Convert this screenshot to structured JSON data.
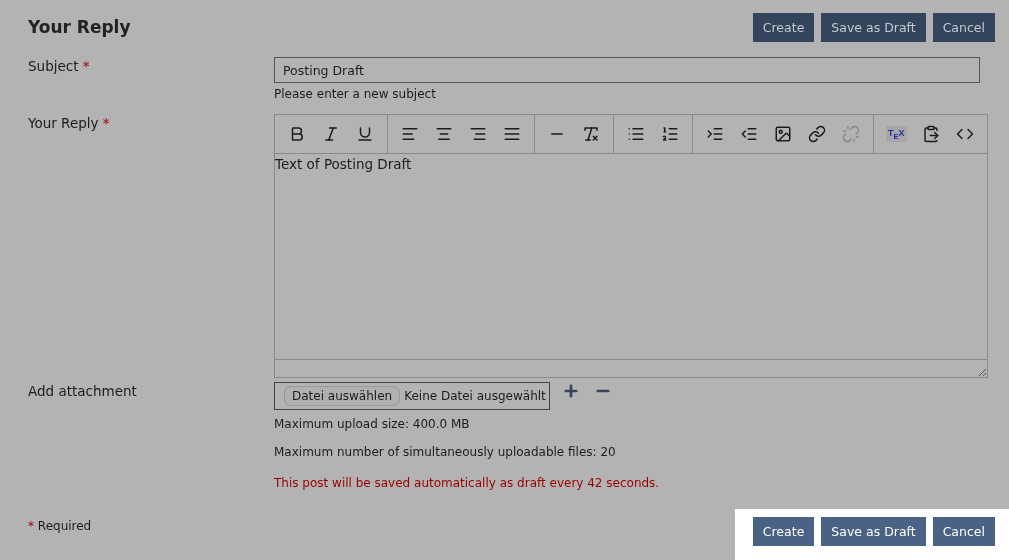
{
  "title": "Your Reply",
  "top_buttons": [
    "Create",
    "Save as Draft",
    "Cancel"
  ],
  "subject": {
    "label": "Subject",
    "required_mark": "*",
    "value": "Posting Draft",
    "hint": "Please enter a new subject"
  },
  "reply": {
    "label": "Your Reply",
    "required_mark": "*",
    "toolbar": [
      [
        {
          "kind": "bold",
          "disabled": false
        },
        {
          "kind": "italic",
          "disabled": false
        },
        {
          "kind": "underline",
          "disabled": false
        }
      ],
      [
        {
          "kind": "align-left",
          "disabled": false
        },
        {
          "kind": "align-center",
          "disabled": false
        },
        {
          "kind": "align-right",
          "disabled": false
        },
        {
          "kind": "justify",
          "disabled": false
        }
      ],
      [
        {
          "kind": "rule",
          "disabled": false
        },
        {
          "kind": "clear-format",
          "disabled": false
        }
      ],
      [
        {
          "kind": "bullets",
          "disabled": false
        },
        {
          "kind": "numbers",
          "disabled": false
        }
      ],
      [
        {
          "kind": "indent",
          "disabled": false
        },
        {
          "kind": "outdent",
          "disabled": false
        },
        {
          "kind": "image",
          "disabled": false
        },
        {
          "kind": "link",
          "disabled": false
        },
        {
          "kind": "unlink",
          "disabled": true
        }
      ],
      [
        {
          "kind": "tex",
          "label": "T$_{E}$X",
          "disabled": false
        },
        {
          "kind": "paste",
          "disabled": false
        },
        {
          "kind": "code",
          "disabled": false
        }
      ]
    ],
    "text": "Text of Posting Draft"
  },
  "attachment": {
    "label": "Add attachment",
    "choose_button": "Datei auswählen",
    "file_status": "Keine Datei ausgewählt",
    "max_size": "Maximum upload size: 400.0 MB",
    "max_files": "Maximum number of simultaneously uploadable files: 20",
    "autosave_note": "This post will be saved automatically as draft every 42 seconds."
  },
  "required_note": {
    "mark": "*",
    "text": "Required"
  },
  "bottom_buttons": [
    "Create",
    "Save as Draft",
    "Cancel"
  ]
}
